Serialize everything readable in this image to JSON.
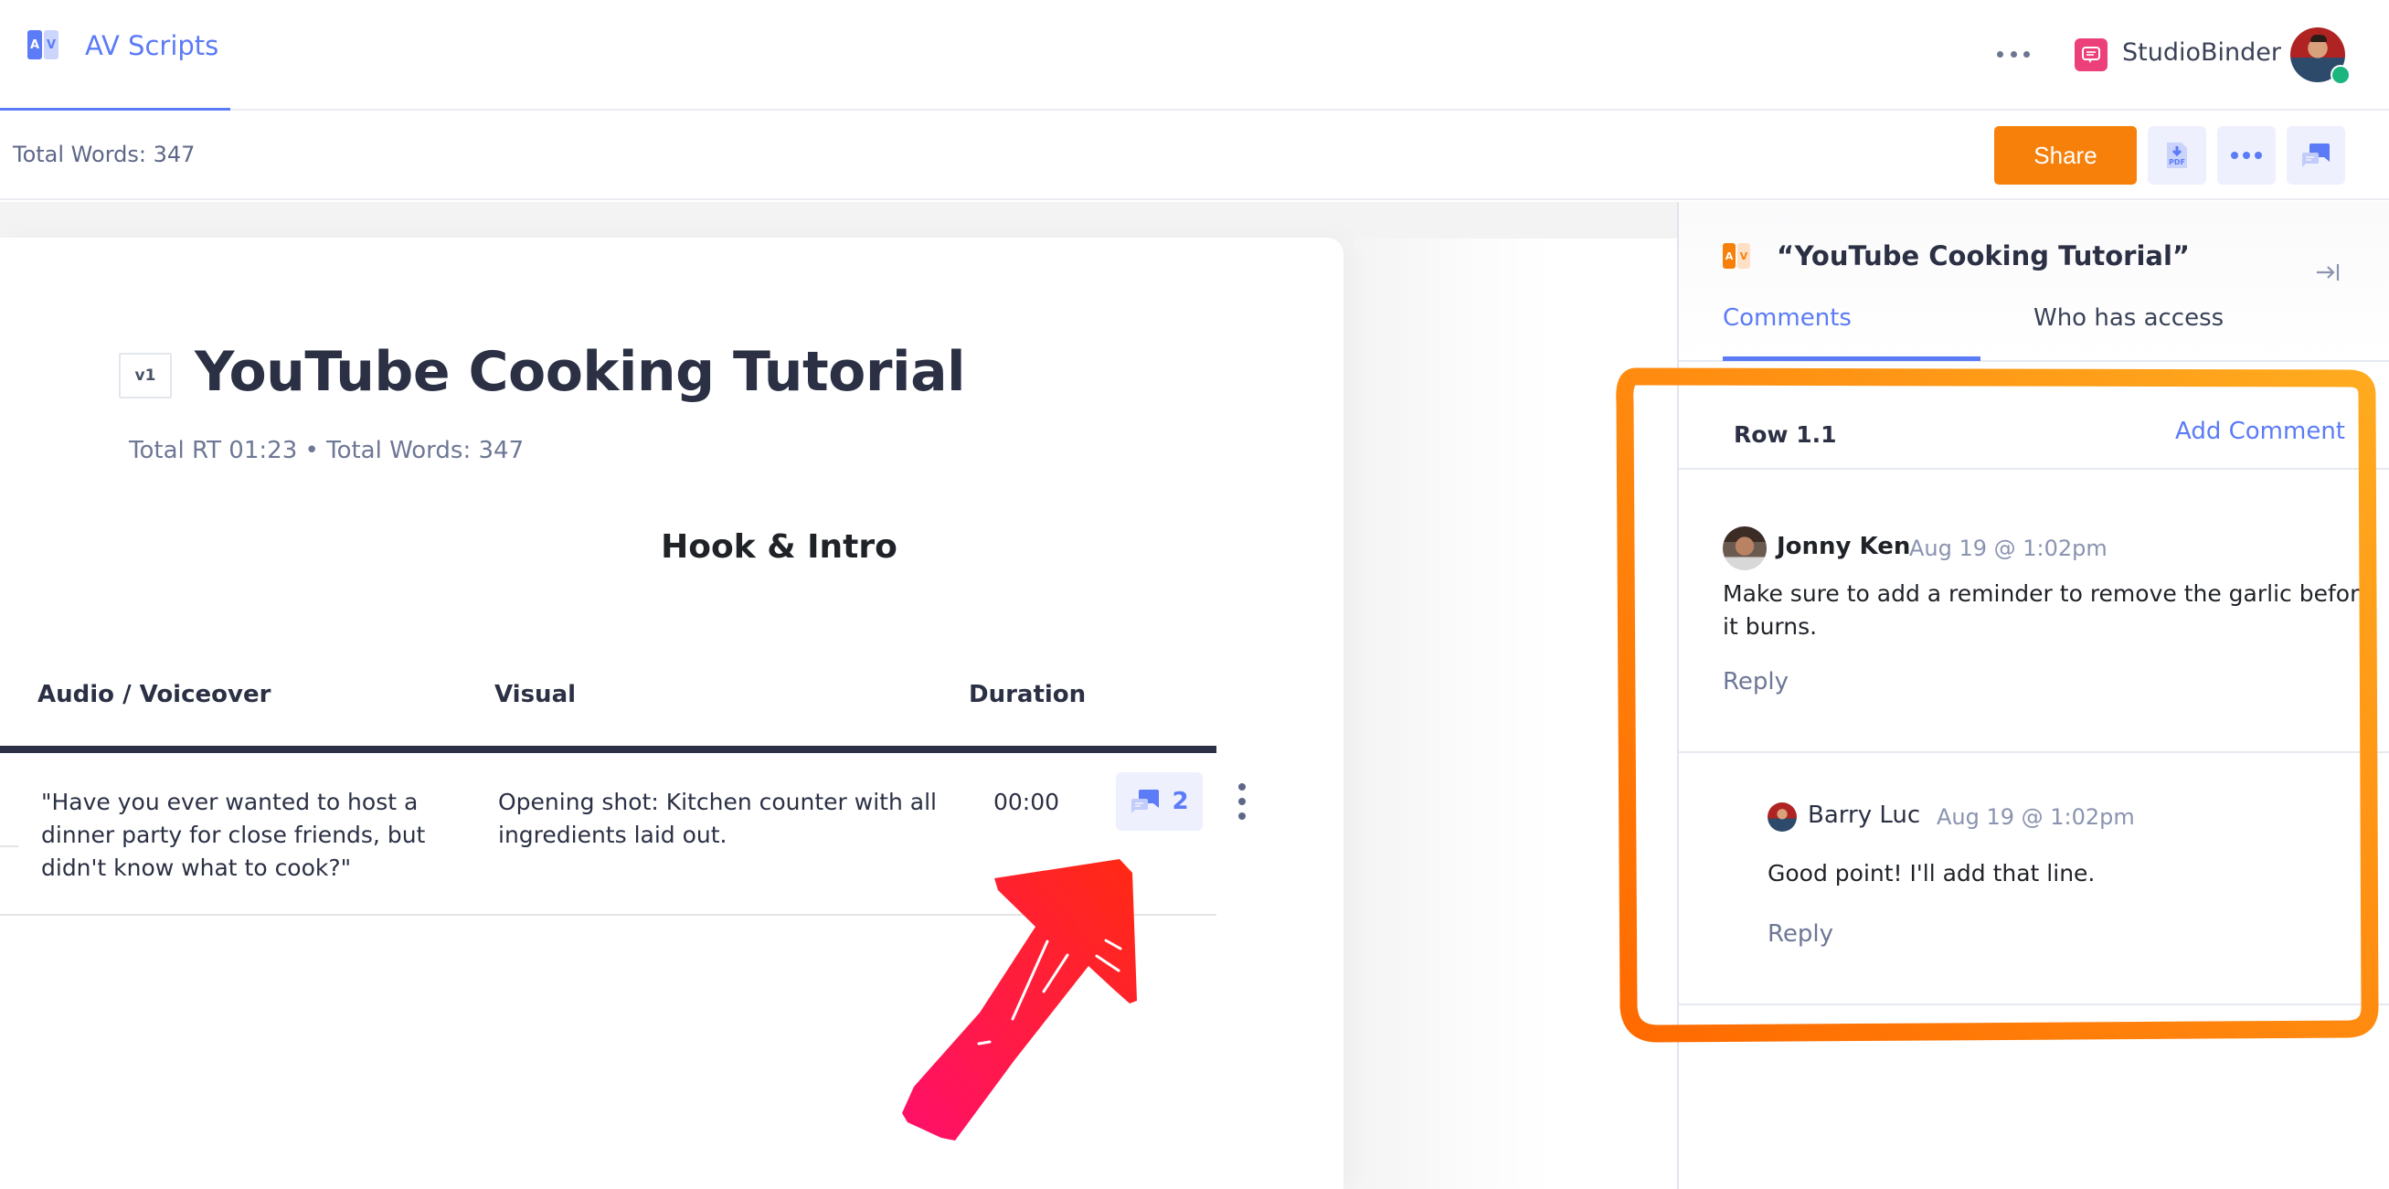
{
  "nav": {
    "app_tab_label": "AV Scripts",
    "app_logo_letters": [
      "A",
      "V"
    ],
    "workspace_name": "StudioBinder",
    "user_status": "online"
  },
  "toolbar": {
    "total_words": "Total Words: 347",
    "share_label": "Share",
    "pdf_icon_label": "PDF"
  },
  "document": {
    "version": "v1",
    "title": "YouTube Cooking Tutorial",
    "meta": "Total RT 01:23 • Total Words: 347",
    "section_title": "Hook & Intro",
    "columns": [
      "Audio / Voiceover",
      "Visual",
      "Duration"
    ],
    "rows": [
      {
        "audio": "\"Have you ever wanted to host a dinner party for close friends, but didn't know what to cook?\"",
        "visual": "Opening shot: Kitchen counter with all ingredients laid out.",
        "duration": "00:00",
        "comment_count": "2"
      }
    ]
  },
  "panel": {
    "title": "“YouTube Cooking Tutorial”",
    "tabs": [
      {
        "label": "Comments",
        "active": true
      },
      {
        "label": "Who has access",
        "active": false
      }
    ],
    "thread": {
      "row_label": "Row 1.1",
      "add_comment_label": "Add Comment",
      "comments": [
        {
          "author": "Jonny Ken",
          "time": "Aug 19 @ 1:02pm",
          "body": "Make sure to add a reminder to remove the garlic before it burns.",
          "reply_label": "Reply"
        },
        {
          "author": "Barry Luc",
          "time": "Aug 19 @ 1:02pm",
          "body": "Good point! I'll add that line.",
          "reply_label": "Reply"
        }
      ]
    }
  },
  "colors": {
    "accent": "#5b7bf7",
    "share": "#f7800b",
    "highlight_box": "#f98a10",
    "arrow_start": "#ff0f6b",
    "arrow_end": "#ff2a12"
  }
}
